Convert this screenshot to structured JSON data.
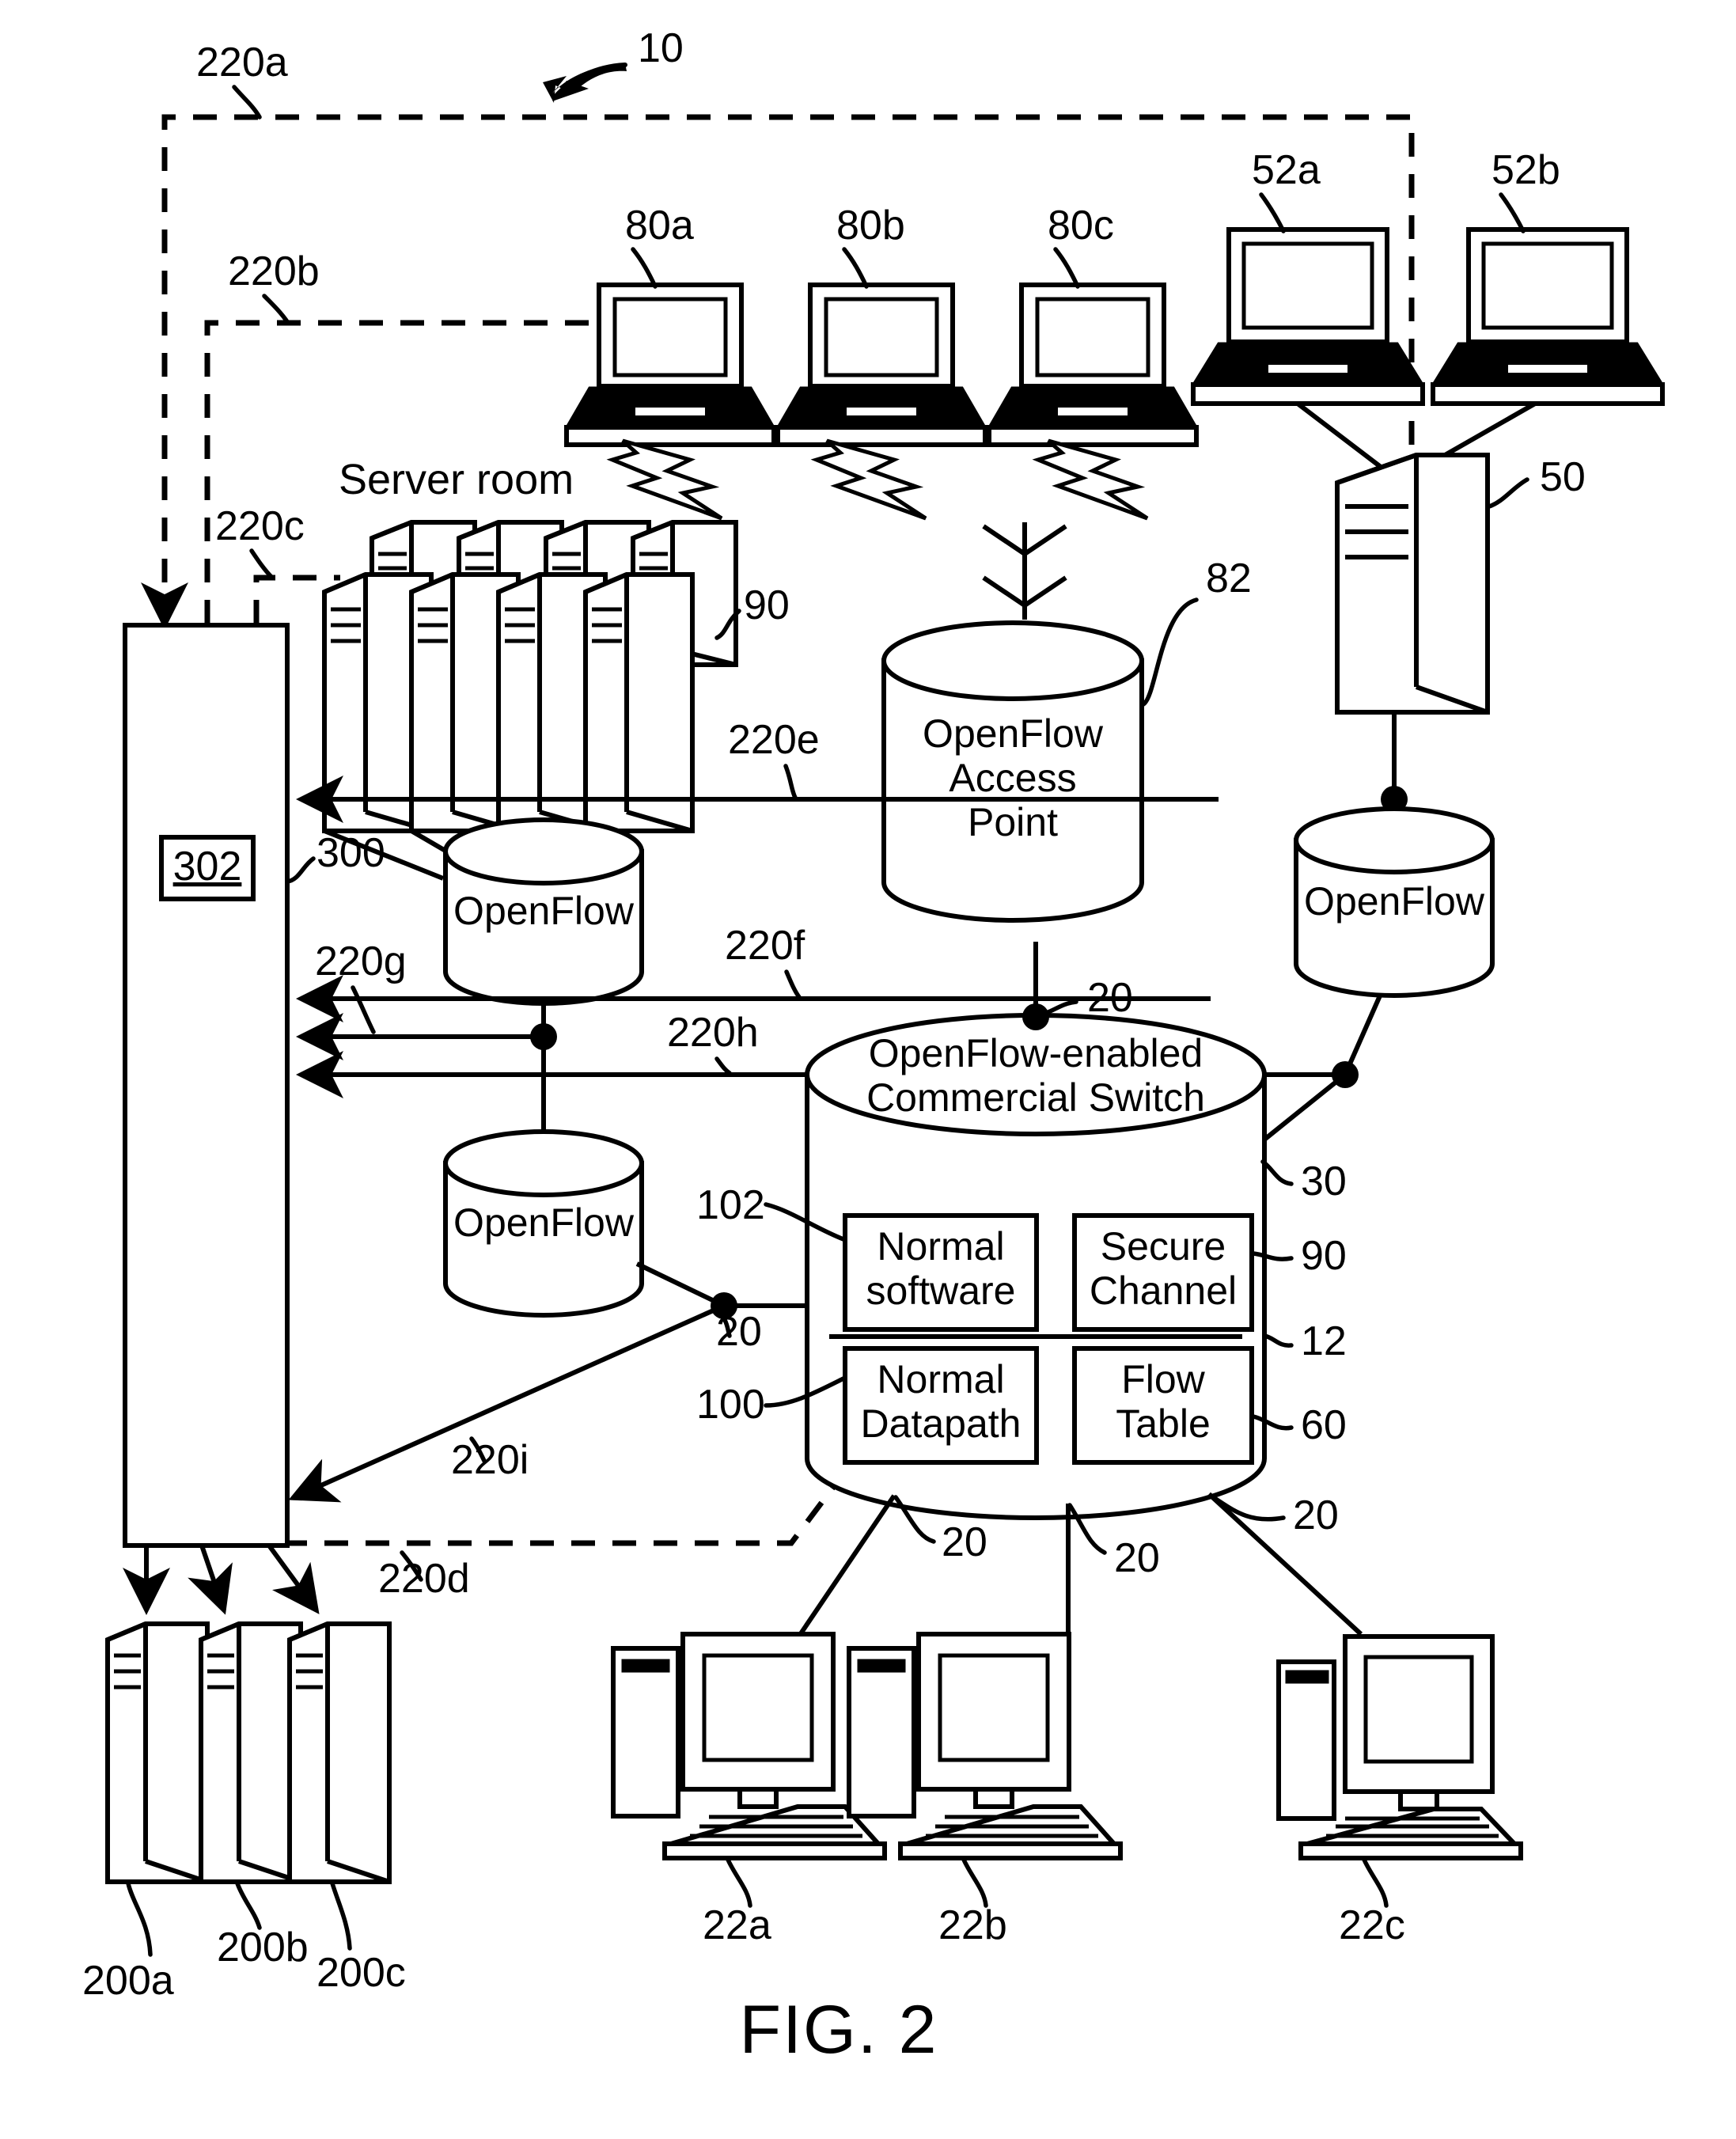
{
  "figure": {
    "caption": "FIG. 2",
    "system_ref": "10"
  },
  "labels": {
    "server_room": "Server room",
    "openflow": "OpenFlow",
    "openflow_access_point_l1": "OpenFlow",
    "openflow_access_point_l2": "Access",
    "openflow_access_point_l3": "Point",
    "switch_line1": "OpenFlow-enabled",
    "switch_line2": "Commercial Switch",
    "normal_software_l1": "Normal",
    "normal_software_l2": "software",
    "secure_channel_l1": "Secure",
    "secure_channel_l2": "Channel",
    "normal_datapath_l1": "Normal",
    "normal_datapath_l2": "Datapath",
    "flow_table_l1": "Flow",
    "flow_table_l2": "Table",
    "controller_inner": "302"
  },
  "refs": {
    "r10": "10",
    "r12": "12",
    "r20_a": "20",
    "r20_b": "20",
    "r20_c": "20",
    "r20_d": "20",
    "r20_e": "20",
    "r22a": "22a",
    "r22b": "22b",
    "r22c": "22c",
    "r30": "30",
    "r50": "50",
    "r52a": "52a",
    "r52b": "52b",
    "r60": "60",
    "r80a": "80a",
    "r80b": "80b",
    "r80c": "80c",
    "r82": "82",
    "r90_racks": "90",
    "r90_channel": "90",
    "r100": "100",
    "r102": "102",
    "r200a": "200a",
    "r200b": "200b",
    "r200c": "200c",
    "r220a": "220a",
    "r220b": "220b",
    "r220c": "220c",
    "r220d": "220d",
    "r220e": "220e",
    "r220f": "220f",
    "r220g": "220g",
    "r220h": "220h",
    "r220i": "220i",
    "r300": "300"
  },
  "colors": {
    "stroke": "#000000",
    "background": "#ffffff"
  }
}
